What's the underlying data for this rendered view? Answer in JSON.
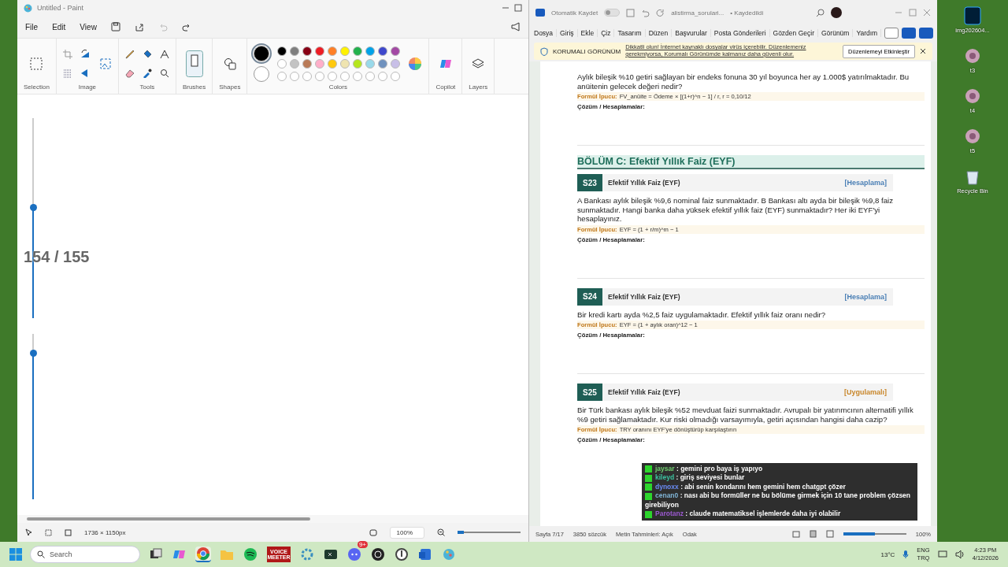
{
  "paint": {
    "title": "Untitled - Paint",
    "menu": [
      "File",
      "Edit",
      "View"
    ],
    "groups": [
      {
        "label": "Selection"
      },
      {
        "label": "Image"
      },
      {
        "label": "Tools"
      },
      {
        "label": "Brushes"
      },
      {
        "label": "Shapes"
      },
      {
        "label": "Colors"
      },
      {
        "label": "Copilot"
      },
      {
        "label": "Layers"
      }
    ],
    "current_colors": [
      {
        "color": "#000000",
        "selected": true
      },
      {
        "color": "#ffffff",
        "selected": false
      }
    ],
    "swatches": [
      {
        "color": "#000000"
      },
      {
        "color": "#7f7f7f"
      },
      {
        "color": "#880015"
      },
      {
        "color": "#ed1c24"
      },
      {
        "color": "#ff7f27"
      },
      {
        "color": "#fff200"
      },
      {
        "color": "#22b14c"
      },
      {
        "color": "#00a2e8"
      },
      {
        "color": "#3f48cc"
      },
      {
        "color": "#a349a4"
      },
      {
        "color": "#ffffff"
      },
      {
        "color": "#c3c3c3"
      },
      {
        "color": "#b97a57"
      },
      {
        "color": "#ffaec9"
      },
      {
        "color": "#ffc90e"
      },
      {
        "color": "#efe4b0"
      },
      {
        "color": "#b5e61d"
      },
      {
        "color": "#99d9ea"
      },
      {
        "color": "#7092be"
      },
      {
        "color": "#c8bfe7"
      }
    ],
    "sliders": [
      {
        "level": 0.55
      },
      {
        "level": 0.88
      }
    ],
    "overlay_counter": "154 / 155",
    "status": {
      "size": "1736 × 1150px",
      "zoom": "100%",
      "zoom_slider": {
        "level": 0.1
      }
    }
  },
  "word": {
    "autosave_label": "Otomatik Kaydet",
    "autosave_on": false,
    "filename": "alistirma_sorulari...",
    "save_status": "• Kaydedildi",
    "tabs": [
      "Dosya",
      "Giriş",
      "Ekle",
      "Çiz",
      "Tasarım",
      "Düzen",
      "Başvurular",
      "Posta Gönderileri",
      "Gözden Geçir",
      "Görünüm",
      "Yardım"
    ],
    "protected": {
      "label": "KORUMALI GÖRÜNÜM",
      "message": "Dikkatli olun! İnternet kaynaklı dosyalar virüs içerebilir. Düzenlemeniz gerekmiyorsa, Korumalı Görünümde kalmanız daha güvenli olur.",
      "button": "Düzenlemeyi Etkinleştir"
    },
    "intro": {
      "text": "Aylık bileşik %10 getiri sağlayan bir endeks fonuna 30 yıl boyunca her ay 1.000$ yatırılmaktadır. Bu anüitenin gelecek değeri nedir?",
      "hint_label": "Formül İpucu:",
      "hint": "FV_anüite = Ödeme × [(1+r)^n − 1] / r, r = 0,10/12",
      "solution": "Çözüm / Hesaplamalar:"
    },
    "section": "BÖLÜM C: Efektif Yıllık Faiz (EYF)",
    "questions": [
      {
        "number": "S23",
        "topic": "Efektif Yıllık Faiz (EYF)",
        "tag": "[Hesaplama]",
        "color": "#4a7fb5",
        "text": "A Bankası aylık bileşik %9,6 nominal faiz sunmaktadır. B Bankası altı ayda bir bileşik %9,8 faiz sunmaktadır. Hangi banka daha yüksek efektif yıllık faiz (EYF) sunmaktadır? Her iki EYF'yi hesaplayınız.",
        "hint_label": "Formül İpucu:",
        "hint": "EYF = (1 + r/m)^m − 1",
        "solution": "Çözüm / Hesaplamalar:"
      },
      {
        "number": "S24",
        "topic": "Efektif Yıllık Faiz (EYF)",
        "tag": "[Hesaplama]",
        "color": "#4a7fb5",
        "text": "Bir kredi kartı ayda %2,5 faiz uygulamaktadır. Efektif yıllık faiz oranı nedir?",
        "hint_label": "Formül İpucu:",
        "hint": "EYF = (1 + aylık oran)^12 − 1",
        "solution": "Çözüm / Hesaplamalar:"
      },
      {
        "number": "S25",
        "topic": "Efektif Yıllık Faiz (EYF)",
        "tag": "[Uygulamalı]",
        "color": "#c8862a",
        "text": "Bir Türk bankası aylık bileşik %52 mevduat faizi sunmaktadır. Avrupalı bir yatırımcının alternatifi yıllık %9 getiri sağlamaktadır. Kur riski olmadığı varsayımıyla, getiri açısından hangisi daha cazip?",
        "hint_label": "Formül İpucu:",
        "hint": "TRY oranını EYF'ye dönüştürüp karşılaştırın",
        "solution": "Çözüm / Hesaplamalar:"
      }
    ],
    "status": {
      "page": "Sayfa 7/17",
      "words": "3850 sözcük",
      "predictions": "Metin Tahminleri: Açık",
      "focus": "Odak",
      "zoom": "100%",
      "zoom_slider": {
        "level": 0.5
      }
    }
  },
  "desktop_icons": [
    {
      "label": "img202604...",
      "kind": "psd"
    },
    {
      "label": "t3",
      "kind": "plant"
    },
    {
      "label": "t4",
      "kind": "plant"
    },
    {
      "label": "t5",
      "kind": "plant"
    },
    {
      "label": "Recycle Bin",
      "kind": "bin"
    }
  ],
  "chat": [
    {
      "user": "jaysar",
      "color": "#6fcf6f",
      "message": ": gemini pro baya iş yapıyo"
    },
    {
      "user": "kileyd",
      "color": "#3cc2a0",
      "message": ": giriş seviyesi bunlar"
    },
    {
      "user": "dynoxx",
      "color": "#6a8cf5",
      "message": ": abi senin kondarını hem gemini hem chatgpt çözer"
    },
    {
      "user": "cenan0",
      "color": "#7fb3d5",
      "message": ": nası abi bu formüller ne bu bölüme girmek için 10 tane problem çözsen girebiliyon"
    },
    {
      "user": "Parotanz",
      "color": "#9b59d0",
      "message": ": claude matematiksel işlemlerde daha iyi olabilir"
    }
  ],
  "taskbar": {
    "search_placeholder": "Search",
    "apps": [
      {
        "kind": "taskview"
      },
      {
        "kind": "copilot"
      },
      {
        "kind": "chrome",
        "active": true
      },
      {
        "kind": "folder"
      },
      {
        "kind": "spotify"
      },
      {
        "kind": "voicemeeter",
        "label": "VOICE MEETER"
      },
      {
        "kind": "gear"
      },
      {
        "kind": "terminal"
      },
      {
        "kind": "discord",
        "badge": "9+"
      },
      {
        "kind": "obs"
      },
      {
        "kind": "overwatch"
      },
      {
        "kind": "word"
      },
      {
        "kind": "paint"
      }
    ],
    "weather": "13°C",
    "lang": "ENG",
    "layout": "TRQ",
    "time": "4:23 PM",
    "date": "4/12/2026"
  }
}
